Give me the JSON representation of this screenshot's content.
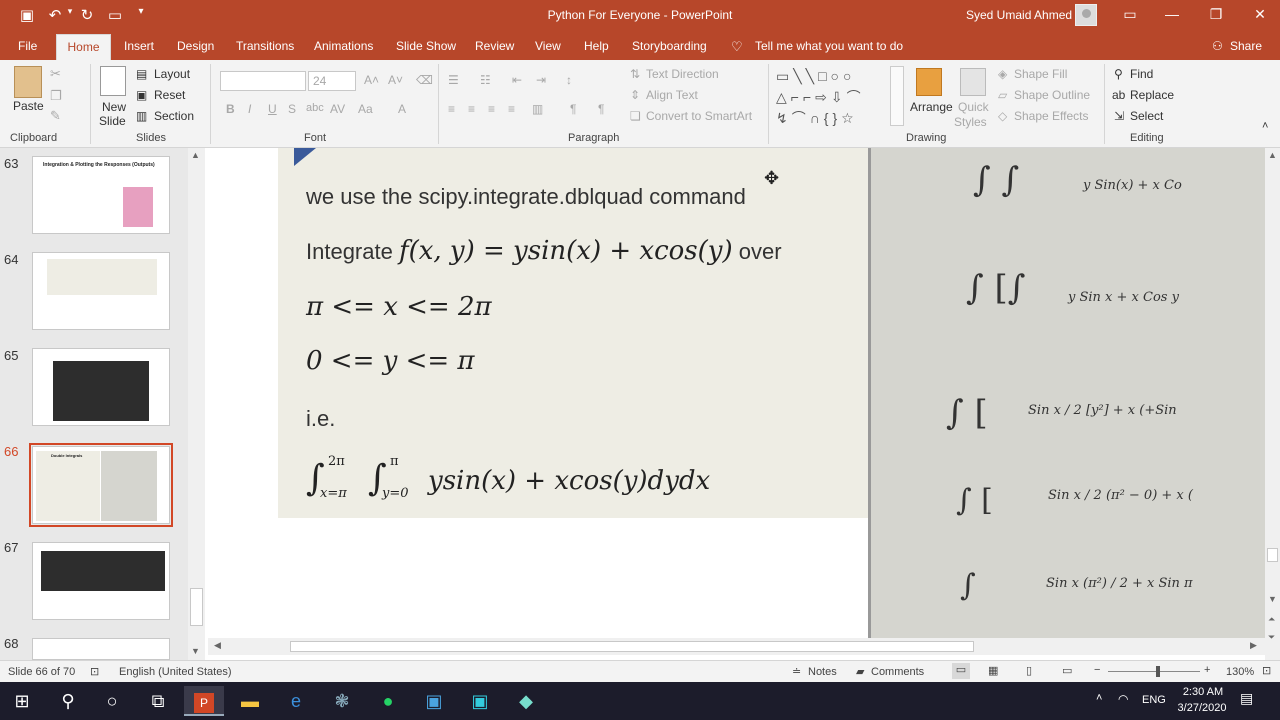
{
  "window": {
    "app_title": "Python For Everyone  -  PowerPoint",
    "user_name": "Syed Umaid Ahmed"
  },
  "tabs": [
    {
      "label": "File"
    },
    {
      "label": "Home"
    },
    {
      "label": "Insert"
    },
    {
      "label": "Design"
    },
    {
      "label": "Transitions"
    },
    {
      "label": "Animations"
    },
    {
      "label": "Slide Show"
    },
    {
      "label": "Review"
    },
    {
      "label": "View"
    },
    {
      "label": "Help"
    },
    {
      "label": "Storyboarding"
    }
  ],
  "tell_me": "Tell me what you want to do",
  "share": "Share",
  "ribbon": {
    "clipboard": {
      "paste": "Paste",
      "label": "Clipboard"
    },
    "slides": {
      "new_slide_1": "New",
      "new_slide_2": "Slide",
      "layout": "Layout",
      "reset": "Reset",
      "section": "Section",
      "label": "Slides"
    },
    "font": {
      "size": "24",
      "label": "Font"
    },
    "paragraph": {
      "text_direction": "Text Direction",
      "align_text": "Align Text",
      "smartart": "Convert to SmartArt",
      "label": "Paragraph"
    },
    "drawing": {
      "arrange": "Arrange",
      "quick_1": "Quick",
      "quick_2": "Styles",
      "shape_fill": "Shape Fill",
      "shape_outline": "Shape Outline",
      "shape_effects": "Shape Effects",
      "label": "Drawing"
    },
    "editing": {
      "find": "Find",
      "replace": "Replace",
      "select": "Select",
      "label": "Editing"
    }
  },
  "slides": [
    {
      "number": "63",
      "title": "Integration & Plotting the Responses (Outputs)"
    },
    {
      "number": "64",
      "title": ""
    },
    {
      "number": "65",
      "title": ""
    },
    {
      "number": "66",
      "title": "Double Integrals"
    },
    {
      "number": "67",
      "title": ""
    },
    {
      "number": "68",
      "title": ""
    }
  ],
  "slide": {
    "line1": "we use the scipy.integrate.dblquad command",
    "line2_prefix": "Integrate ",
    "line2_math": "f(x, y) = ysin(x) + xcos(y)",
    "line2_suffix": " over",
    "line3": "π <= x <= 2π",
    "line4": "0 <= y <= π",
    "line5": "i.e.",
    "integral_expr": "ysin(x) + xcos(y)dydx",
    "outer_upper": "2π",
    "outer_lower": "x=π",
    "inner_upper": "π",
    "inner_lower": "y=0"
  },
  "handwriting": [
    "y Sin(x)  +  x Co",
    "y Sin x  +  x Cos y",
    "Sin x / 2 [y²]  +  x (+Sin",
    "Sin x / 2 (π² − 0)  +  x (",
    "Sin x (π²) / 2  +  x Sin π"
  ],
  "status": {
    "slide_info": "Slide 66 of 70",
    "language": "English (United States)",
    "notes": "Notes",
    "comments": "Comments",
    "zoom": "130%"
  },
  "taskbar": {
    "time": "2:30 AM",
    "date": "3/27/2020",
    "lang": "ENG"
  },
  "colors": {
    "accent": "#b7472a",
    "selection": "#d24726",
    "slide_bg": "#eeede4"
  }
}
